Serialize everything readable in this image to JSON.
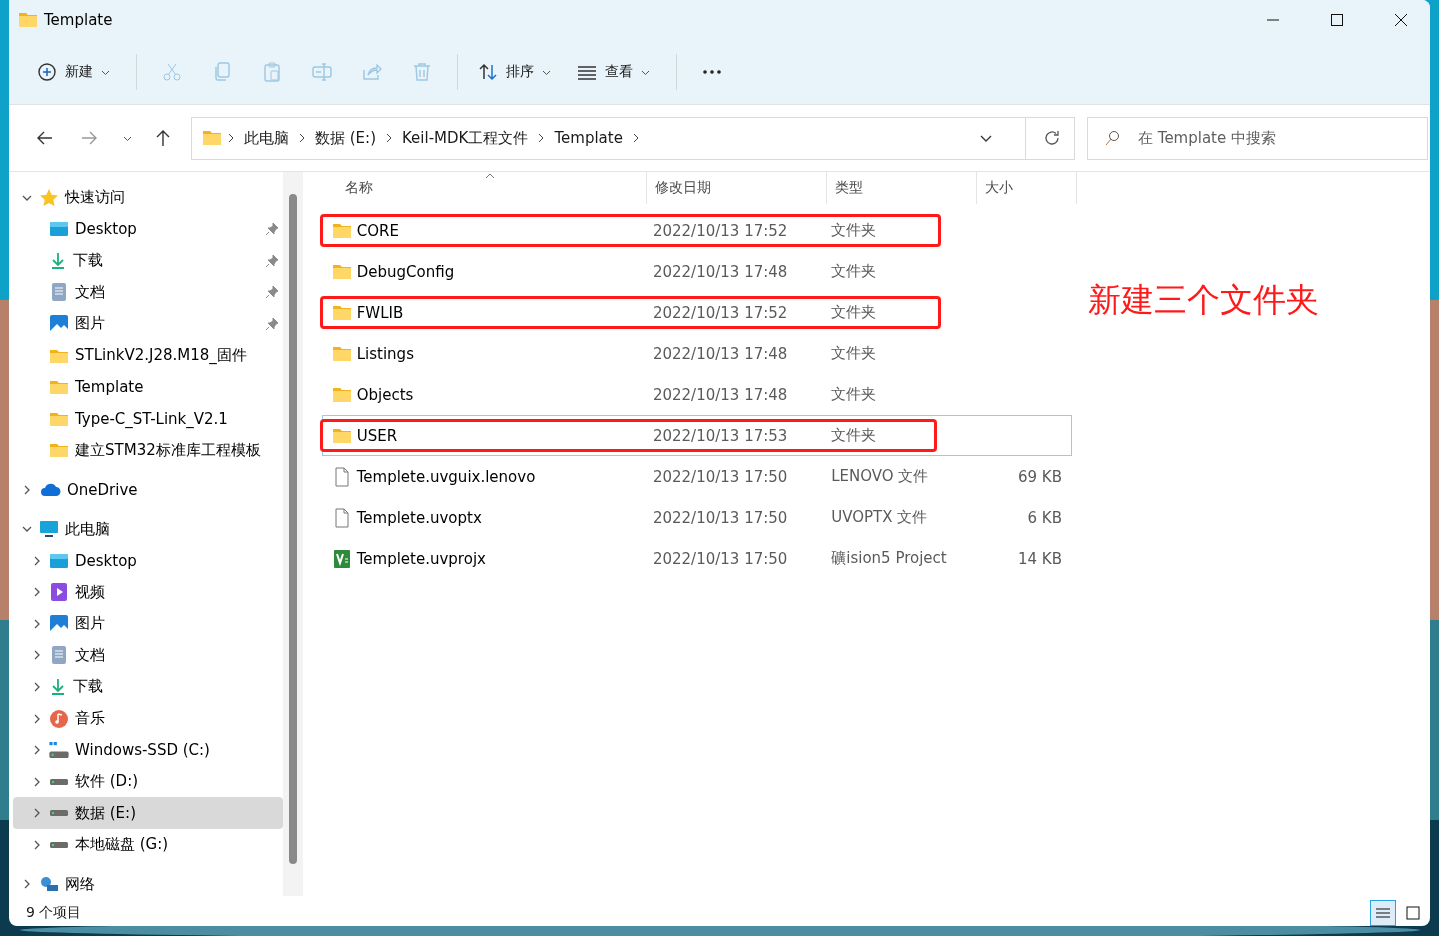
{
  "window": {
    "title": "Template"
  },
  "toolbar": [
    {
      "kind": "new",
      "label": "新建",
      "disabled": false
    },
    {
      "kind": "cut",
      "disabled": true
    },
    {
      "kind": "copy",
      "disabled": true
    },
    {
      "kind": "paste",
      "disabled": true
    },
    {
      "kind": "rename",
      "disabled": true
    },
    {
      "kind": "share",
      "disabled": true
    },
    {
      "kind": "delete",
      "disabled": true
    },
    {
      "kind": "sort",
      "label": "排序",
      "disabled": false
    },
    {
      "kind": "view",
      "label": "查看",
      "disabled": false
    },
    {
      "kind": "more",
      "disabled": false
    }
  ],
  "address": {
    "crumbs": [
      "此电脑",
      "数据 (E:)",
      "Keil-MDK工程文件",
      "Template"
    ]
  },
  "search": {
    "placeholder": "在 Template 中搜索"
  },
  "sidebar": {
    "items": [
      {
        "label": "快速访问",
        "kind": "star",
        "expanded": true,
        "selected": false,
        "children": [
          {
            "label": "Desktop",
            "kind": "desktop",
            "pinned": true,
            "selected": false
          },
          {
            "label": "下载",
            "kind": "download",
            "pinned": true,
            "selected": false
          },
          {
            "label": "文档",
            "kind": "documents",
            "pinned": true,
            "selected": false
          },
          {
            "label": "图片",
            "kind": "pictures",
            "pinned": true,
            "selected": false
          },
          {
            "label": "STLinkV2.J28.M18_固件",
            "kind": "folder",
            "pinned": false,
            "selected": false
          },
          {
            "label": "Template",
            "kind": "folder",
            "pinned": false,
            "selected": false
          },
          {
            "label": "Type-C_ST-Link_V2.1",
            "kind": "folder",
            "pinned": false,
            "selected": false
          },
          {
            "label": "建立STM32标准库工程模板",
            "kind": "folder",
            "pinned": false,
            "selected": false
          }
        ]
      },
      {
        "label": "OneDrive",
        "kind": "cloud",
        "expanded": false,
        "selected": false
      },
      {
        "label": "此电脑",
        "kind": "pc",
        "expanded": true,
        "selected": false,
        "children": [
          {
            "label": "Desktop",
            "kind": "desktop",
            "expanded": false,
            "selected": false
          },
          {
            "label": "视频",
            "kind": "video",
            "expanded": false,
            "selected": false
          },
          {
            "label": "图片",
            "kind": "pictures",
            "expanded": false,
            "selected": false
          },
          {
            "label": "文档",
            "kind": "documents",
            "expanded": false,
            "selected": false
          },
          {
            "label": "下载",
            "kind": "download",
            "expanded": false,
            "selected": false
          },
          {
            "label": "音乐",
            "kind": "music",
            "expanded": false,
            "selected": false
          },
          {
            "label": "Windows-SSD (C:)",
            "kind": "drive-windows",
            "expanded": false,
            "selected": false
          },
          {
            "label": "软件 (D:)",
            "kind": "drive",
            "expanded": false,
            "selected": false
          },
          {
            "label": "数据 (E:)",
            "kind": "drive",
            "expanded": false,
            "selected": true
          },
          {
            "label": "本地磁盘 (G:)",
            "kind": "drive",
            "expanded": false,
            "selected": false
          }
        ]
      },
      {
        "label": "网络",
        "kind": "network",
        "expanded": false,
        "selected": false
      }
    ]
  },
  "table": {
    "columns": [
      {
        "label": "名称",
        "sorted": true
      },
      {
        "label": "修改日期",
        "sorted": false
      },
      {
        "label": "类型",
        "sorted": false
      },
      {
        "label": "大小",
        "sorted": false
      }
    ],
    "rows": [
      {
        "kind": "folder",
        "name": "CORE",
        "date": "2022/10/13 17:52",
        "type": "文件夹",
        "highlighted": true,
        "focused": false
      },
      {
        "kind": "folder",
        "name": "DebugConfig",
        "date": "2022/10/13 17:48",
        "type": "文件夹",
        "highlighted": false,
        "focused": false
      },
      {
        "kind": "folder",
        "name": "FWLIB",
        "date": "2022/10/13 17:52",
        "type": "文件夹",
        "highlighted": true,
        "focused": false
      },
      {
        "kind": "folder",
        "name": "Listings",
        "date": "2022/10/13 17:48",
        "type": "文件夹",
        "highlighted": false,
        "focused": false
      },
      {
        "kind": "folder",
        "name": "Objects",
        "date": "2022/10/13 17:48",
        "type": "文件夹",
        "highlighted": false,
        "focused": false
      },
      {
        "kind": "folder",
        "name": "USER",
        "date": "2022/10/13 17:53",
        "type": "文件夹",
        "highlighted": true,
        "focused": true
      },
      {
        "kind": "file",
        "name": "Templete.uvguix.lenovo",
        "date": "2022/10/13 17:50",
        "type": "LENOVO 文件",
        "size": "69 KB",
        "highlighted": false,
        "focused": false
      },
      {
        "kind": "file",
        "name": "Templete.uvoptx",
        "date": "2022/10/13 17:50",
        "type": "UVOPTX 文件",
        "size": "6 KB",
        "highlighted": false,
        "focused": false
      },
      {
        "kind": "uvision",
        "name": "Templete.uvprojx",
        "date": "2022/10/13 17:50",
        "type": "礦ision5 Project",
        "size": "14 KB",
        "highlighted": false,
        "focused": false
      }
    ]
  },
  "annotation": "新建三个文件夹",
  "status_bar": {
    "text": "9 个项目",
    "views": [
      {
        "kind": "details",
        "selected": true
      },
      {
        "kind": "tiles",
        "selected": false
      }
    ]
  }
}
